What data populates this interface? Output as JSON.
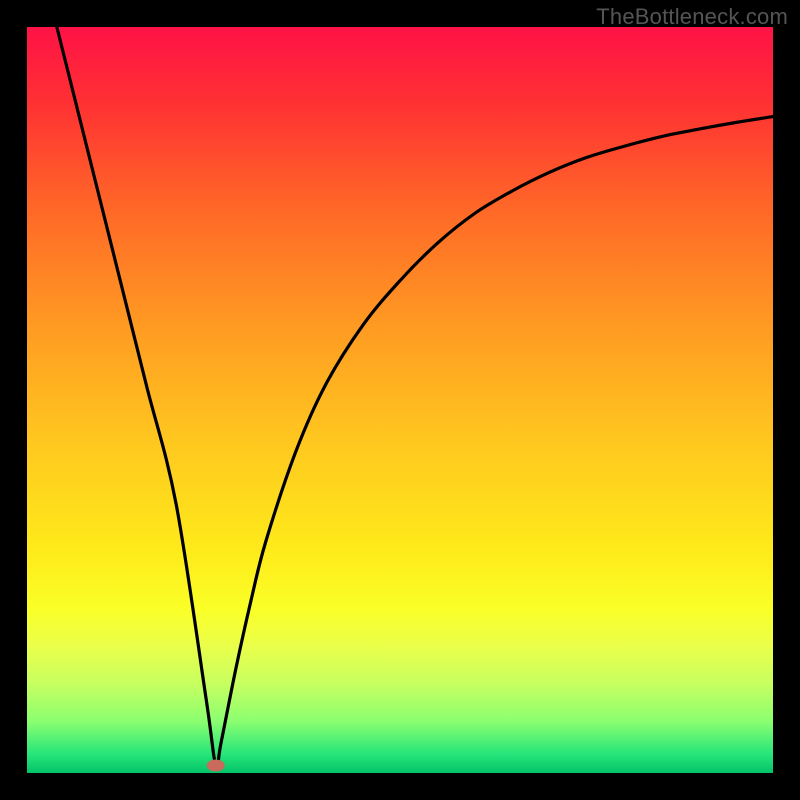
{
  "watermark": "TheBottleneck.com",
  "chart_data": {
    "type": "line",
    "title": "",
    "xlabel": "",
    "ylabel": "",
    "xlim": [
      0,
      100
    ],
    "ylim": [
      0,
      100
    ],
    "background": "rainbow-vertical-gradient (red top to green bottom)",
    "curve_description": "V-shaped bottleneck curve: steep linear descent from top-left to a minimum near x≈25, then asymptotic rise toward top-right",
    "minimum_marker": {
      "x": 25.3,
      "y": 1.0,
      "color": "#c96a5c"
    },
    "series": [
      {
        "name": "bottleneck-curve",
        "x": [
          4.0,
          8,
          12,
          16,
          20,
          24,
          25.3,
          26,
          28,
          30,
          32,
          36,
          40,
          45,
          50,
          55,
          60,
          65,
          70,
          75,
          80,
          85,
          90,
          95,
          100
        ],
        "y": [
          100,
          84,
          68,
          52,
          36,
          10,
          1.0,
          4,
          14,
          23,
          31,
          43,
          52,
          60,
          66,
          71,
          75,
          78,
          80.5,
          82.5,
          84,
          85.3,
          86.3,
          87.2,
          88
        ]
      }
    ],
    "gradient_stops": [
      {
        "offset": 0.0,
        "color": "#ff1246"
      },
      {
        "offset": 0.1,
        "color": "#ff3033"
      },
      {
        "offset": 0.25,
        "color": "#ff6a27"
      },
      {
        "offset": 0.4,
        "color": "#ff9a22"
      },
      {
        "offset": 0.55,
        "color": "#ffc61f"
      },
      {
        "offset": 0.7,
        "color": "#feea1a"
      },
      {
        "offset": 0.78,
        "color": "#faff27"
      },
      {
        "offset": 0.83,
        "color": "#eaff4a"
      },
      {
        "offset": 0.88,
        "color": "#c7ff60"
      },
      {
        "offset": 0.93,
        "color": "#8cff70"
      },
      {
        "offset": 0.975,
        "color": "#25e57a"
      },
      {
        "offset": 1.0,
        "color": "#04c368"
      }
    ]
  }
}
